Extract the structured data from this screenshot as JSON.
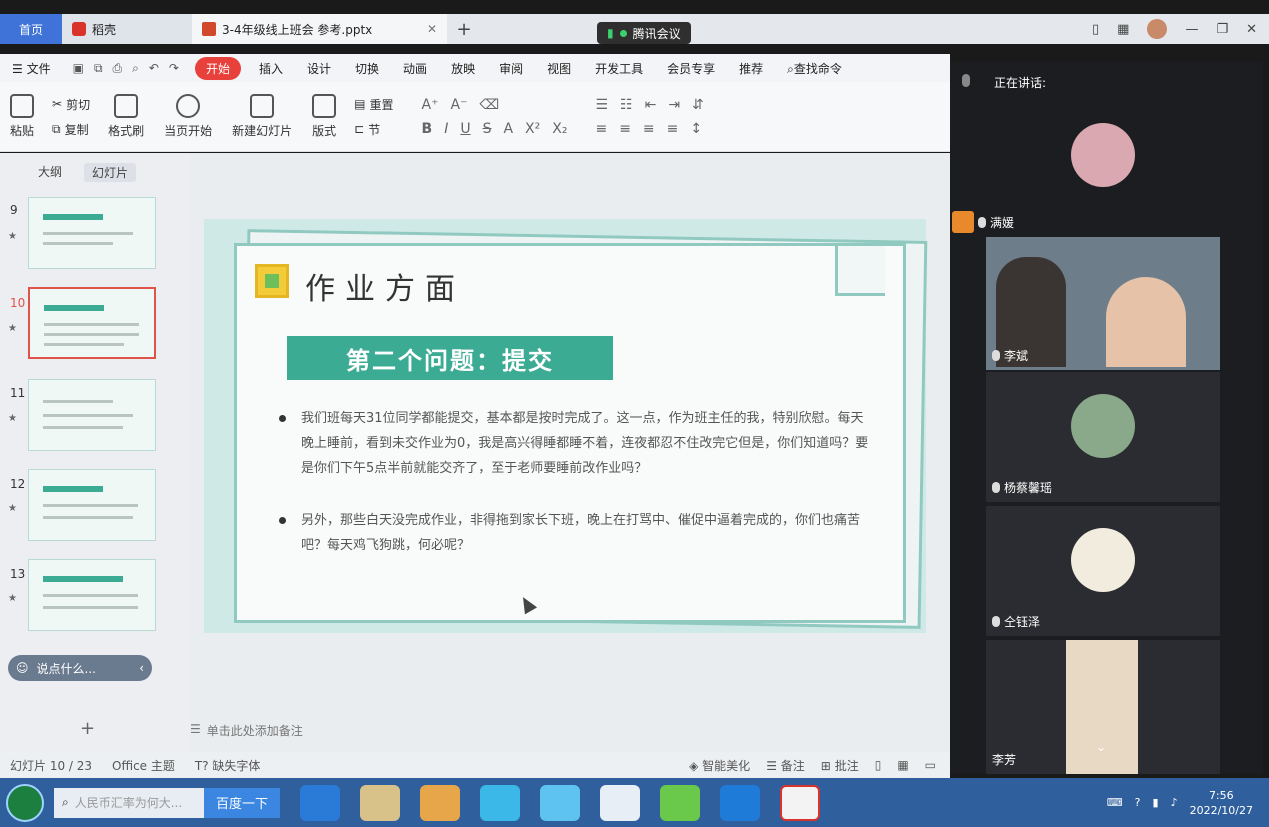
{
  "tabs": {
    "home": "首页",
    "daoke": "稻壳",
    "document": "3-4年级线上班会 参考.pptx",
    "new_tab": "+"
  },
  "meeting_badge": "腾讯会议",
  "menu": {
    "file": "文件",
    "items": [
      "开始",
      "插入",
      "设计",
      "切换",
      "动画",
      "放映",
      "审阅",
      "视图",
      "开发工具",
      "会员专享",
      "推荐"
    ],
    "search": "查找命令"
  },
  "ribbon": {
    "paste": "粘贴",
    "cut": "剪切",
    "copy": "复制",
    "format_painter": "格式刷",
    "from_current": "当页开始",
    "new_slide": "新建幻灯片",
    "layout": "版式",
    "section": "节",
    "reset": "重置"
  },
  "slide_panel": {
    "tab_outline": "大纲",
    "tab_slides": "幻灯片",
    "numbers": [
      "9",
      "10",
      "11",
      "12",
      "13"
    ],
    "chat_placeholder": "说点什么...",
    "add": "+"
  },
  "slide": {
    "title": "作业方面",
    "subtitle": "第二个问题：提交",
    "bullet1": "我们班每天31位同学都能提交，基本都是按时完成了。这一点，作为班主任的我，特别欣慰。每天晚上睡前，看到未交作业为0，我是高兴得睡都睡不着，连夜都忍不住改完它但是，你们知道吗？要是你们下午5点半前就能交齐了，至于老师要睡前改作业吗？",
    "bullet2": "另外，那些白天没完成作业，非得拖到家长下班，晚上在打骂中、催促中逼着完成的，你们也痛苦吧？每天鸡飞狗跳，何必呢？"
  },
  "notes_hint": "单击此处添加备注",
  "status": {
    "slide_count": "幻灯片 10 / 23",
    "theme": "Office 主题",
    "missing_font": "缺失字体",
    "beautify": "智能美化",
    "notes": "备注",
    "comments": "批注"
  },
  "meeting": {
    "speaking_label": "正在讲话:",
    "participants": [
      "满媛",
      "李斌",
      "杨蔡馨瑶",
      "仝钰泽",
      "李芳"
    ]
  },
  "taskbar": {
    "search_placeholder": "人民币汇率为何大...",
    "baidu": "百度一下",
    "time": "7:56",
    "date": "2022/10/27"
  },
  "colors": {
    "accent_red": "#e8403a",
    "slide_green": "#3bab93",
    "home_tab_blue": "#3f73d8"
  }
}
